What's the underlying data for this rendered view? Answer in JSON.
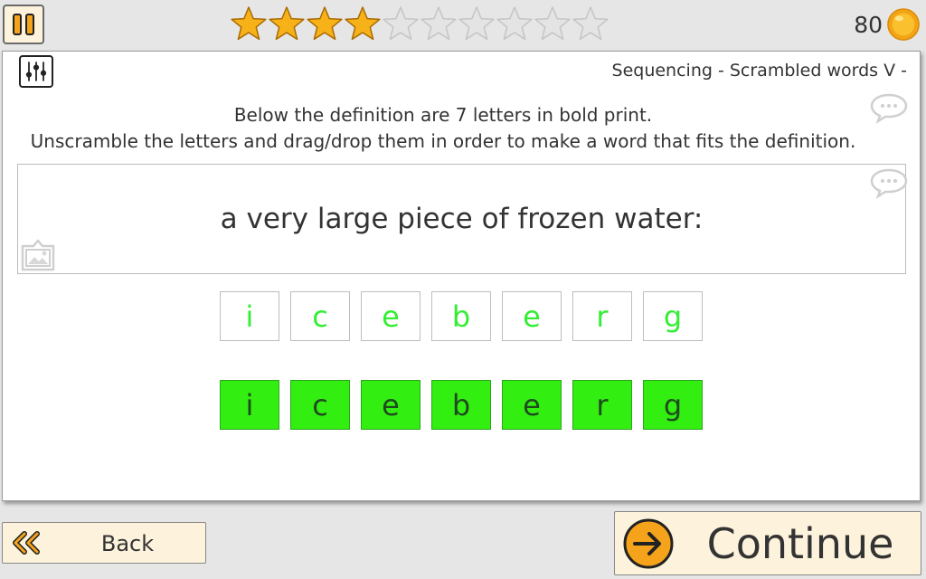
{
  "header": {
    "stars_filled": 4,
    "stars_total": 10,
    "coins": "80"
  },
  "panel": {
    "activity_title": "Sequencing - Scrambled words V -",
    "instructions": [
      "Below the definition are 7 letters in bold print.",
      "Unscramble the letters and drag/drop them in order to make a word that fits the definition."
    ],
    "definition": "a very large piece of frozen water:",
    "scrambled_letters": [
      "i",
      "c",
      "e",
      "b",
      "e",
      "r",
      "g"
    ],
    "answer_letters": [
      "i",
      "c",
      "e",
      "b",
      "e",
      "r",
      "g"
    ]
  },
  "footer": {
    "back_label": "Back",
    "continue_label": "Continue"
  },
  "colors": {
    "star_filled": "#f7b21a",
    "star_empty": "#e4e4e4",
    "tile_green": "#33ee11",
    "letter_green": "#33ee33",
    "button_bg": "#fdf3dc",
    "accent_orange": "#f5a31a"
  },
  "icons": [
    "pause-icon",
    "star-icon",
    "coin-icon",
    "settings-sliders-icon",
    "speech-bubble-icon",
    "image-icon",
    "double-chevron-left-icon",
    "arrow-right-circle-icon"
  ]
}
